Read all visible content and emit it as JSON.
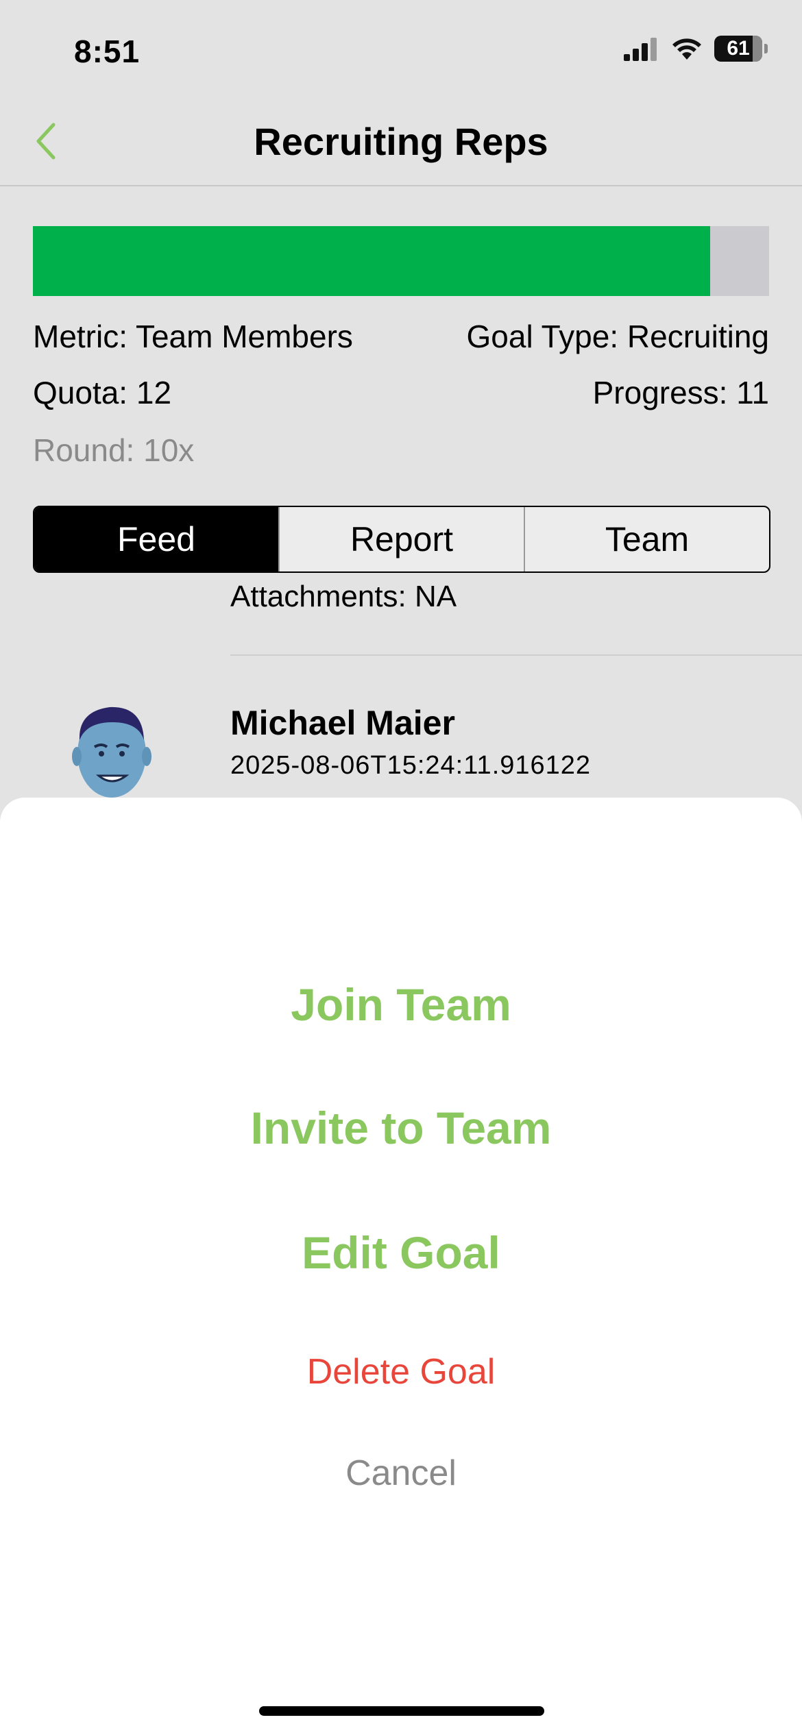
{
  "status_bar": {
    "time": "8:51",
    "battery": "61",
    "icons": [
      "signal-icon",
      "wifi-icon",
      "battery-icon"
    ]
  },
  "nav": {
    "title": "Recruiting Reps",
    "back_icon": "chevron-left-icon"
  },
  "goal": {
    "progress_fraction": 0.92,
    "metric": "Metric: Team Members",
    "goal_type": "Goal Type: Recruiting",
    "quota": "Quota: 12",
    "progress": "Progress: 11",
    "round": "Round: 10x"
  },
  "tabs": [
    {
      "label": "Feed",
      "active": true
    },
    {
      "label": "Report",
      "active": false
    },
    {
      "label": "Team",
      "active": false
    }
  ],
  "feed": {
    "attachments": "Attachments: NA",
    "post": {
      "name": "Michael Maier",
      "timestamp": "2025-08-06T15:24:11.916122"
    }
  },
  "action_sheet": {
    "join": "Join Team",
    "invite": "Invite to Team",
    "edit": "Edit Goal",
    "delete": "Delete Goal",
    "cancel": "Cancel"
  },
  "colors": {
    "accent_green": "#8ac75e",
    "progress_green": "#00b14b",
    "destructive_red": "#e8453b"
  }
}
